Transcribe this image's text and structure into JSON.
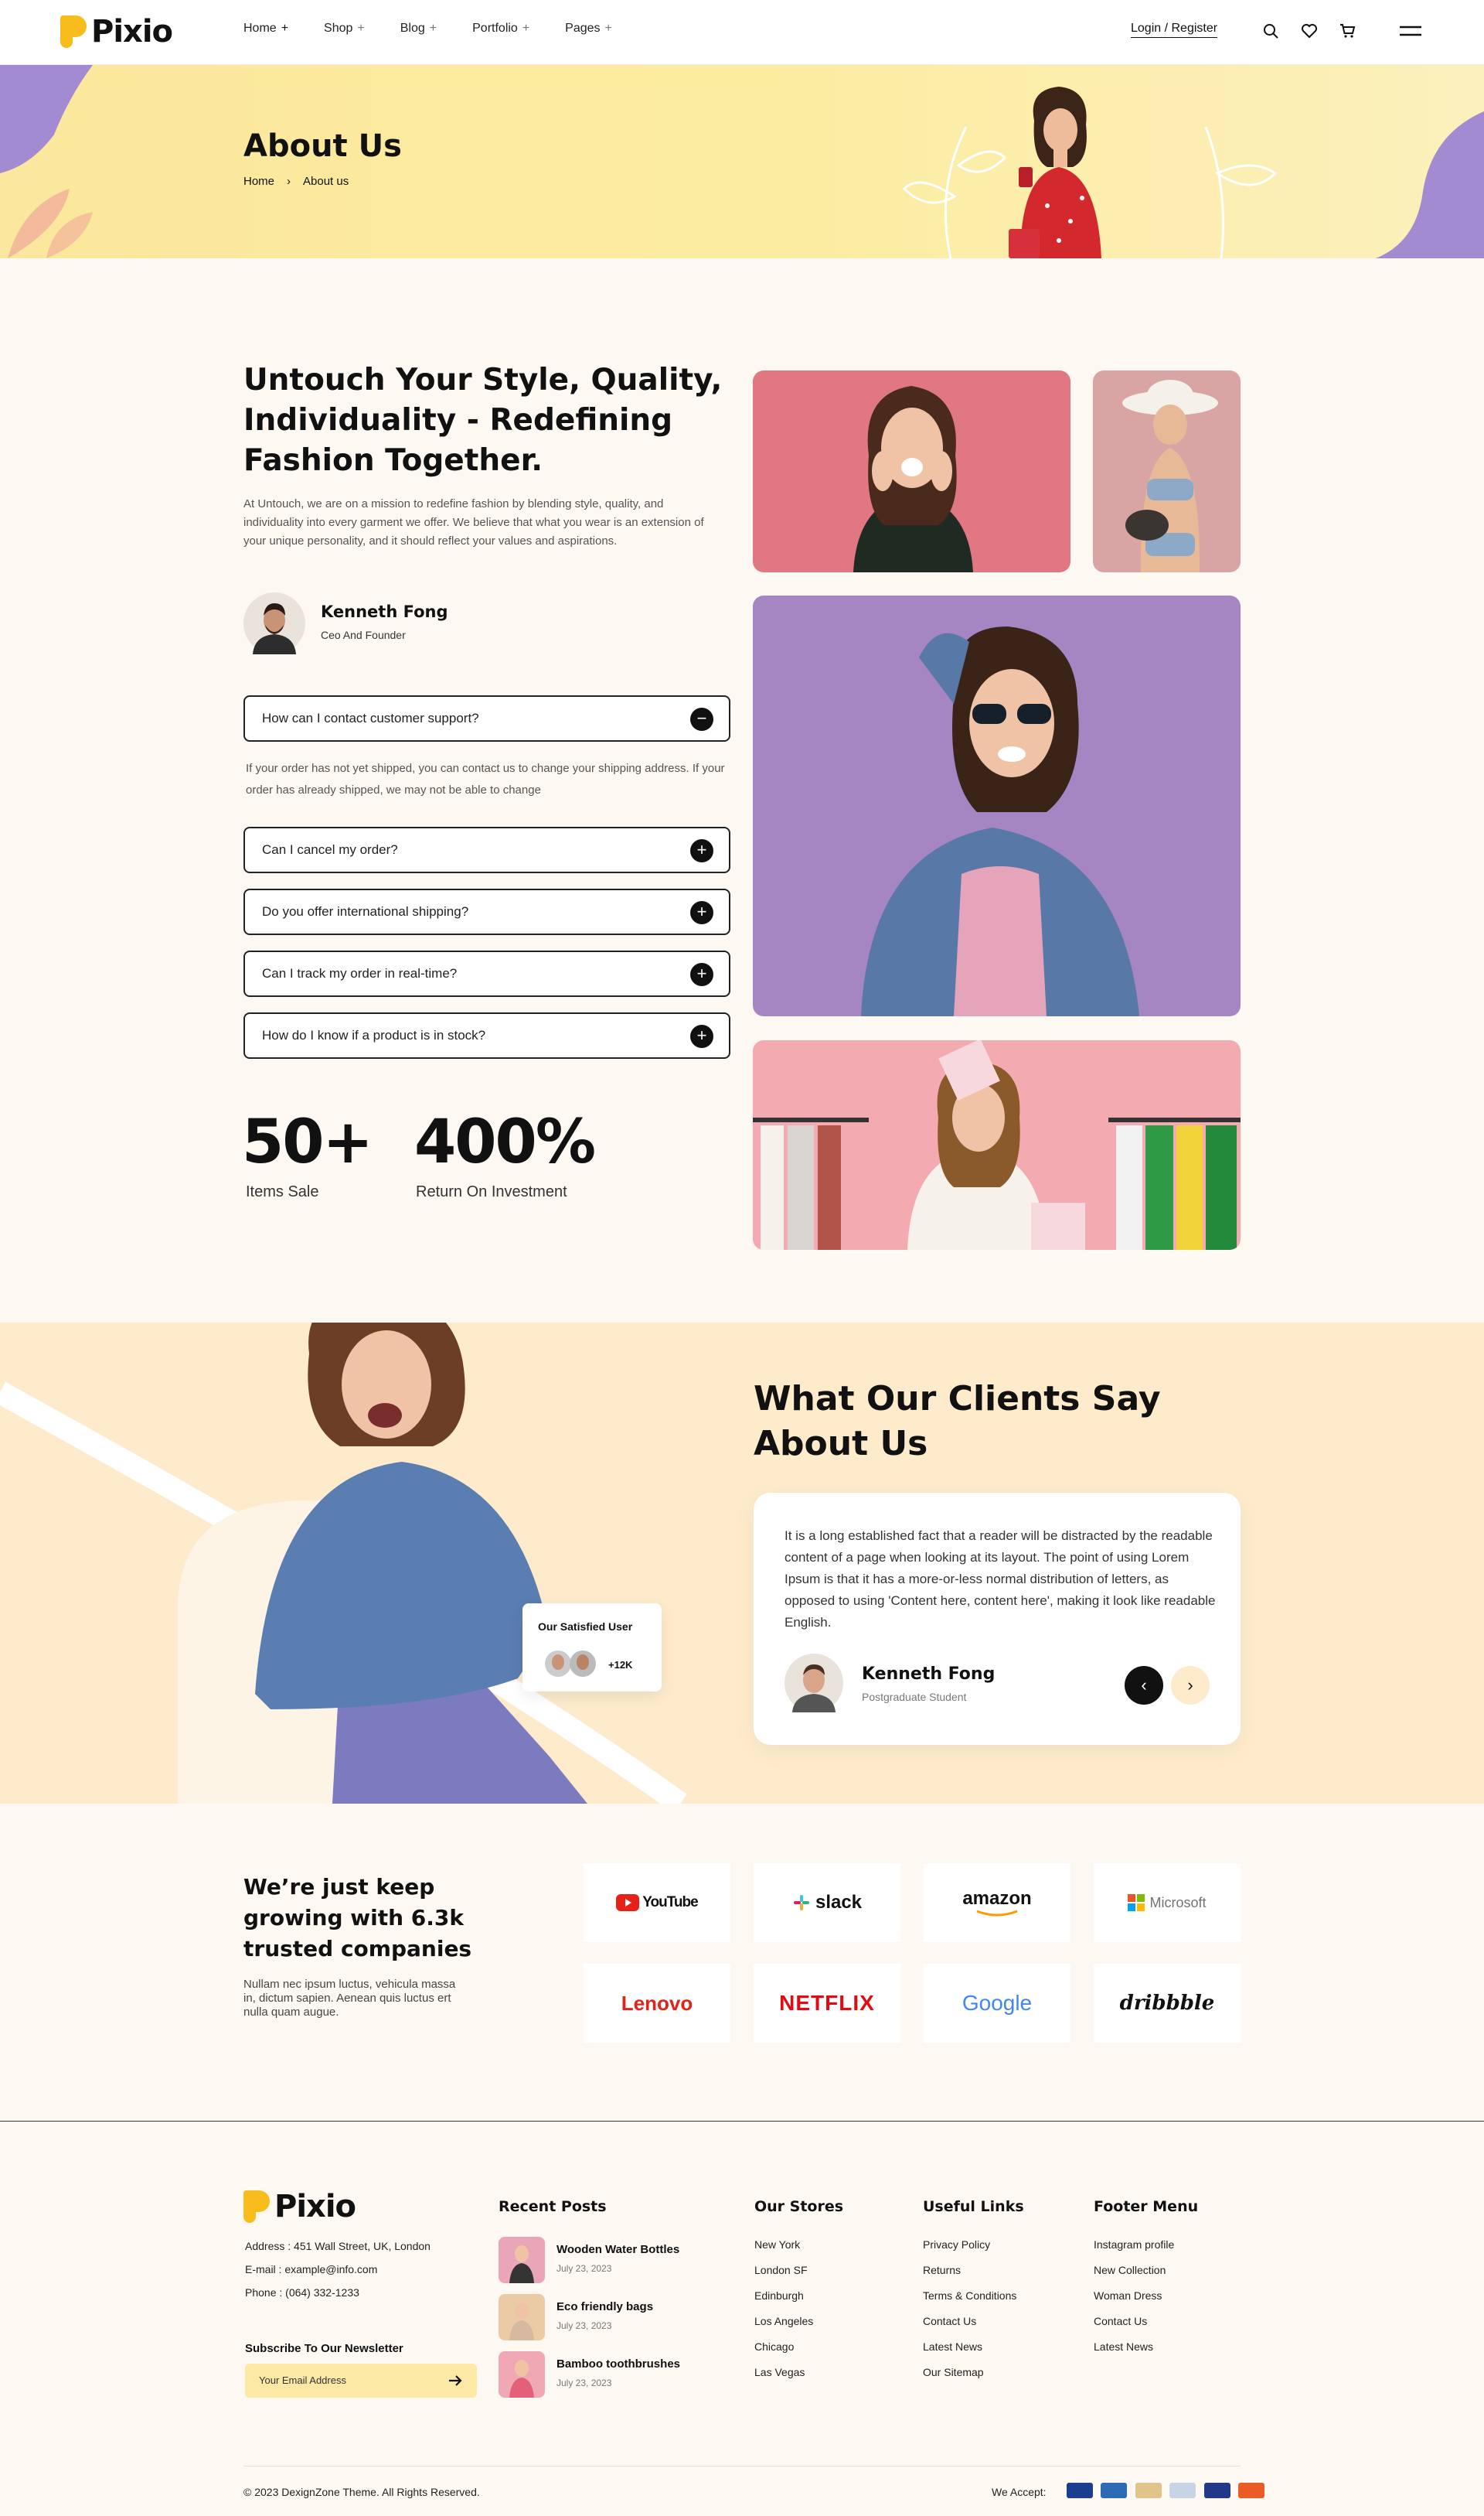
{
  "header": {
    "logo": "Pixio",
    "nav": [
      {
        "label": "Home",
        "plus": "+"
      },
      {
        "label": "Shop",
        "plus": "+"
      },
      {
        "label": "Blog",
        "plus": "+"
      },
      {
        "label": "Portfolio",
        "plus": "+"
      },
      {
        "label": "Pages",
        "plus": "+"
      }
    ],
    "login": "Login / Register",
    "icons": [
      "search-icon",
      "heart-icon",
      "cart-icon",
      "menu-icon"
    ]
  },
  "banner": {
    "title": "About Us",
    "breadcrumb": {
      "home": "Home",
      "sep": "›",
      "current": "About us"
    }
  },
  "about": {
    "title_lines": [
      "Untouch Your Style, Quality,",
      "Individuality - Redefining",
      "Fashion Together."
    ],
    "paragraph": "At Untouch, we are on a mission to redefine fashion by blending style, quality, and individuality into every garment we offer. We believe that what you wear is an extension of your unique personality, and it should reflect your values and aspirations.",
    "author": {
      "name": "Kenneth Fong",
      "role": "Ceo And Founder"
    },
    "faq": [
      {
        "q": "How can I contact customer support?",
        "icon": "−",
        "open": true,
        "answer": "If your order has not yet shipped, you can contact us to change your shipping address. If your order has already shipped, we may not be able to change"
      },
      {
        "q": "Can I cancel my order?",
        "icon": "+"
      },
      {
        "q": "Do you offer international shipping?",
        "icon": "+"
      },
      {
        "q": "Can I track my order in real-time?",
        "icon": "+"
      },
      {
        "q": "How do I know if a product is in stock?",
        "icon": "+"
      }
    ],
    "stats": [
      {
        "value": "50+",
        "label": "Items Sale"
      },
      {
        "value": "400%",
        "label": "Return On Investment"
      }
    ]
  },
  "clients": {
    "title_lines": [
      "What Our Clients Say",
      "About Us"
    ],
    "quote": "It is a long established fact that a reader will be distracted by the readable content of a page when looking at its layout. The point of using Lorem Ipsum is that it has a more-or-less normal distribution of letters, as opposed to using 'Content here, content here', making it look like readable English.",
    "author": {
      "name": "Kenneth Fong",
      "role": "Postgraduate Student"
    },
    "satisfied": {
      "title": "Our Satisfied User",
      "count": "+12K"
    }
  },
  "brands": {
    "title_lines": [
      "We’re just keep",
      "growing with 6.3k",
      "trusted companies"
    ],
    "text_lines": [
      "Nullam nec ipsum luctus, vehicula massa",
      "in, dictum sapien. Aenean quis luctus ert",
      "nulla quam augue."
    ],
    "logos": [
      "YouTube",
      "slack",
      "amazon",
      "Microsoft",
      "Lenovo",
      "NETFLIX",
      "Google",
      "dribbble"
    ]
  },
  "footer": {
    "logo": "Pixio",
    "address": "Address : 451 Wall Street, UK, London",
    "email": "E-mail : example@info.com",
    "phone": "Phone : (064) 332-1233",
    "newsletter_title": "Subscribe To Our Newsletter",
    "newsletter_placeholder": "Your Email Address",
    "recent_title": "Recent Posts",
    "posts": [
      {
        "title": "Wooden Water Bottles",
        "date": "July 23, 2023"
      },
      {
        "title": "Eco friendly bags",
        "date": "July 23, 2023"
      },
      {
        "title": "Bamboo toothbrushes",
        "date": "July 23, 2023"
      }
    ],
    "stores_title": "Our Stores",
    "stores": [
      "New York",
      "London SF",
      "Edinburgh",
      "Los Angeles",
      "Chicago",
      "Las Vegas"
    ],
    "useful_title": "Useful Links",
    "useful": [
      "Privacy Policy",
      "Returns",
      "Terms & Conditions",
      "Contact Us",
      "Latest News",
      "Our Sitemap"
    ],
    "menu_title": "Footer Menu",
    "menu": [
      "Instagram profile",
      "New Collection",
      "Woman Dress",
      "Contact Us",
      "Latest News"
    ],
    "copyright": "© 2023 DexignZone Theme. All Rights Reserved.",
    "we_accept": "We Accept:"
  },
  "colors": {
    "accent": "#f8bd1c",
    "banner": "#fbe79d",
    "clients_bg": "#fdebcc",
    "dark": "#111111"
  }
}
